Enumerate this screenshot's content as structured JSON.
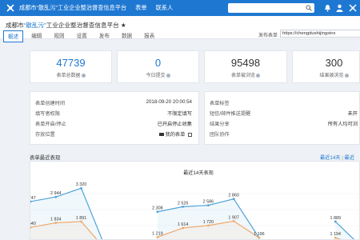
{
  "topbar": {
    "app_title": "成都市“散乱污”工业企业整治督查信息平台",
    "nav": [
      "表单",
      "联系人"
    ],
    "search_placeholder": "",
    "icons": [
      "logo-icon",
      "search-icon",
      "bell-icon",
      "user-icon",
      "settings-icon"
    ]
  },
  "form": {
    "title_prefix": "成都市",
    "title_quote": "“散乱污”",
    "title_suffix": "工业企业整治督查信息平台",
    "tabs": [
      "概述",
      "编辑",
      "规则",
      "设置",
      "发布",
      "数据",
      "报表"
    ],
    "active_tab": "概述",
    "address_label": "发布表单",
    "address_value": "https://chengdushijingxinx"
  },
  "stats": [
    {
      "value": "47739",
      "label": "表单总数据",
      "color": "#1e78d2"
    },
    {
      "value": "0",
      "label": "今日提交",
      "color": "#1e78d2"
    },
    {
      "value": "95498",
      "label": "表单被浏览",
      "color": "#333333"
    },
    {
      "value": "300",
      "label": "结果被浏览",
      "color": "#333333"
    }
  ],
  "info_left": {
    "rows": [
      {
        "label": "表单创建时间",
        "value": "2018-09-20 20:00:54"
      },
      {
        "label": "填写者权限",
        "value": "不限定填写"
      },
      {
        "label": "表单开启/停止",
        "value": "已开启停止收集"
      },
      {
        "label": "存放位置",
        "value": "我的表单"
      }
    ]
  },
  "info_right": {
    "rows": [
      {
        "label": "表单标签",
        "value": ""
      },
      {
        "label": "短信/邮件推送提醒",
        "value": "未开"
      },
      {
        "label": "结果分享",
        "value": "所有人均可浏"
      },
      {
        "label": "团队协作",
        "value": ""
      }
    ]
  },
  "recent": {
    "title": "表单最近表现",
    "links": [
      "最近14天",
      "最近"
    ]
  },
  "chart_data": {
    "type": "line",
    "title": "最近14天表现",
    "series": [
      {
        "color": "#4fa3d8",
        "values": [
          2747,
          2944,
          3320,
          640,
          null,
          2308,
          2526,
          2586,
          2860,
          1196,
          null,
          null,
          1889,
          838
        ]
      },
      {
        "color": "#f0a868",
        "values": [
          1640,
          1834,
          1891,
          640,
          null,
          1219,
          1614,
          1720,
          1907,
          1196,
          null,
          null,
          1194,
          838
        ]
      }
    ],
    "value_labels_top": [
      "2 747",
      "2 944",
      "3 320",
      "2 308",
      "2 526",
      "2 586",
      "2 860",
      "1 889"
    ],
    "value_labels_bottom": [
      "1 640",
      "1 834",
      "1 891",
      "1 219",
      "1 614",
      "1 720",
      "1 907",
      "1 196",
      "1 194",
      "838"
    ]
  },
  "colors": {
    "primary": "#1e78d2",
    "bg": "#eef1f5"
  }
}
